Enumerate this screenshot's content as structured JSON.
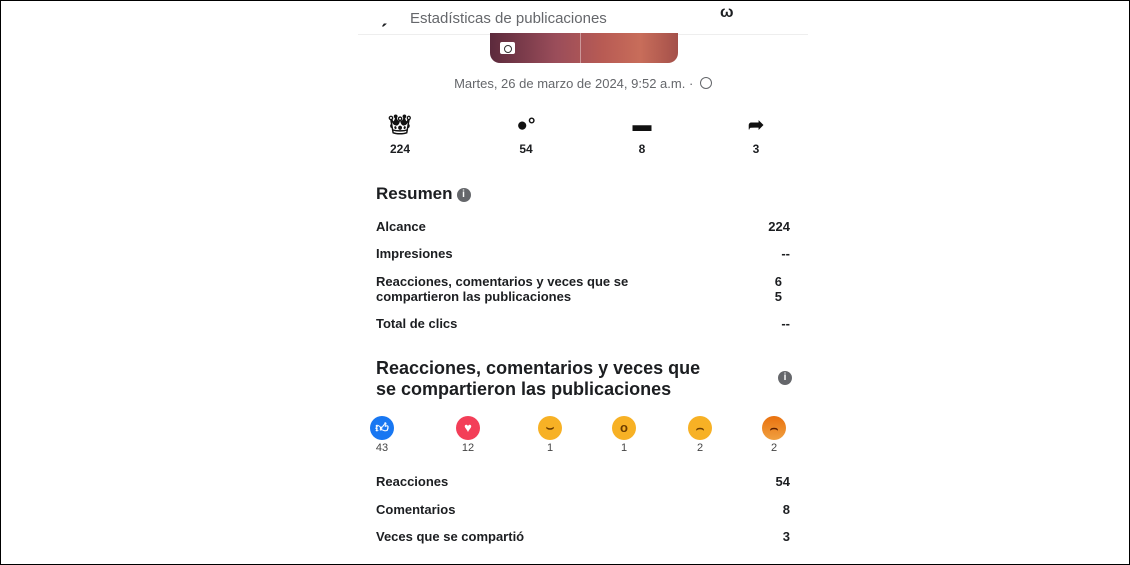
{
  "header": {
    "title": "Estadísticas de publicaciones"
  },
  "post": {
    "date": "Martes, 26 de marzo de 2024, 9:52 a.m. ·"
  },
  "stats": [
    {
      "icon": "crown-reactions-icon",
      "value": "224"
    },
    {
      "icon": "reactions-icon",
      "value": "54"
    },
    {
      "icon": "comment-icon",
      "value": "8"
    },
    {
      "icon": "share-icon",
      "value": "3"
    }
  ],
  "summary": {
    "title": "Resumen",
    "rows": [
      {
        "label": "Alcance",
        "value": "224"
      },
      {
        "label": "Impresiones",
        "value": "--"
      },
      {
        "label_line1": "Reacciones, comentarios y veces que se",
        "label_line2": "compartieron las publicaciones",
        "value_line1": "6",
        "value_line2": "5"
      },
      {
        "label": "Total de clics",
        "value": "--"
      }
    ]
  },
  "engagement": {
    "title_line1": "Reacciones, comentarios y veces que",
    "title_line2": "se compartieron las publicaciones",
    "reactions": [
      {
        "icon": "like-icon",
        "count": "43"
      },
      {
        "icon": "love-icon",
        "count": "12"
      },
      {
        "icon": "haha-icon",
        "count": "1"
      },
      {
        "icon": "wow-icon",
        "count": "1"
      },
      {
        "icon": "sad-icon",
        "count": "2"
      },
      {
        "icon": "angry-icon",
        "count": "2"
      }
    ],
    "rows": [
      {
        "label": "Reacciones",
        "value": "54"
      },
      {
        "label": "Comentarios",
        "value": "8"
      },
      {
        "label": "Veces que se compartió",
        "value": "3"
      }
    ]
  },
  "colors": {
    "like": "#1877f2",
    "love": "#f33e58",
    "yellow": "#f7b125",
    "angry": "#e9710f",
    "muted": "#65676b"
  }
}
